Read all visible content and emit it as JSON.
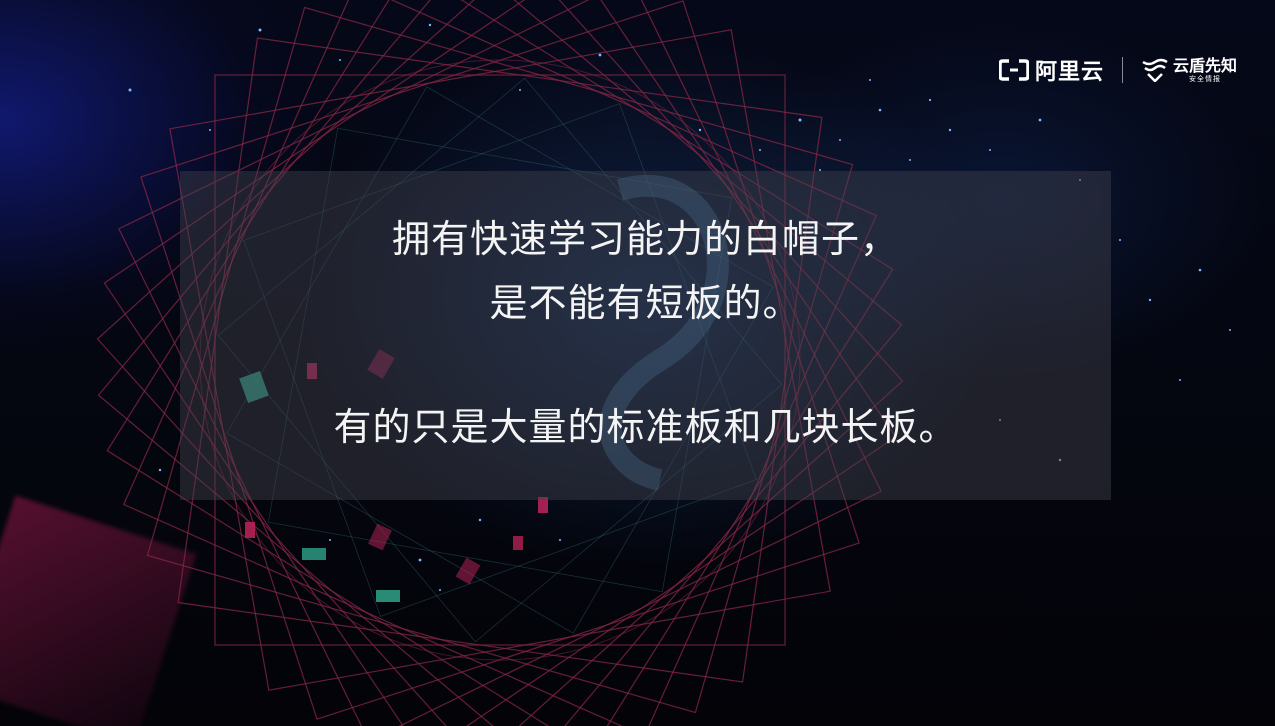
{
  "slide": {
    "lines": [
      "拥有快速学习能力的白帽子，",
      "是不能有短板的。",
      "有的只是大量的标准板和几块长板。"
    ]
  },
  "logos": {
    "aliyun": {
      "text": "阿里云",
      "icon": "aliyun-bracket-icon"
    },
    "xianzhi": {
      "title": "云盾先知",
      "subtitle": "安全情报",
      "icon": "shield-wave-icon"
    }
  },
  "colors": {
    "background": "#04060f",
    "panel": "#46464e",
    "text": "#f4f4f4",
    "frame_lines": "#8a2746",
    "accent_teal": "#2fa38a",
    "accent_pink": "#c0245a"
  }
}
